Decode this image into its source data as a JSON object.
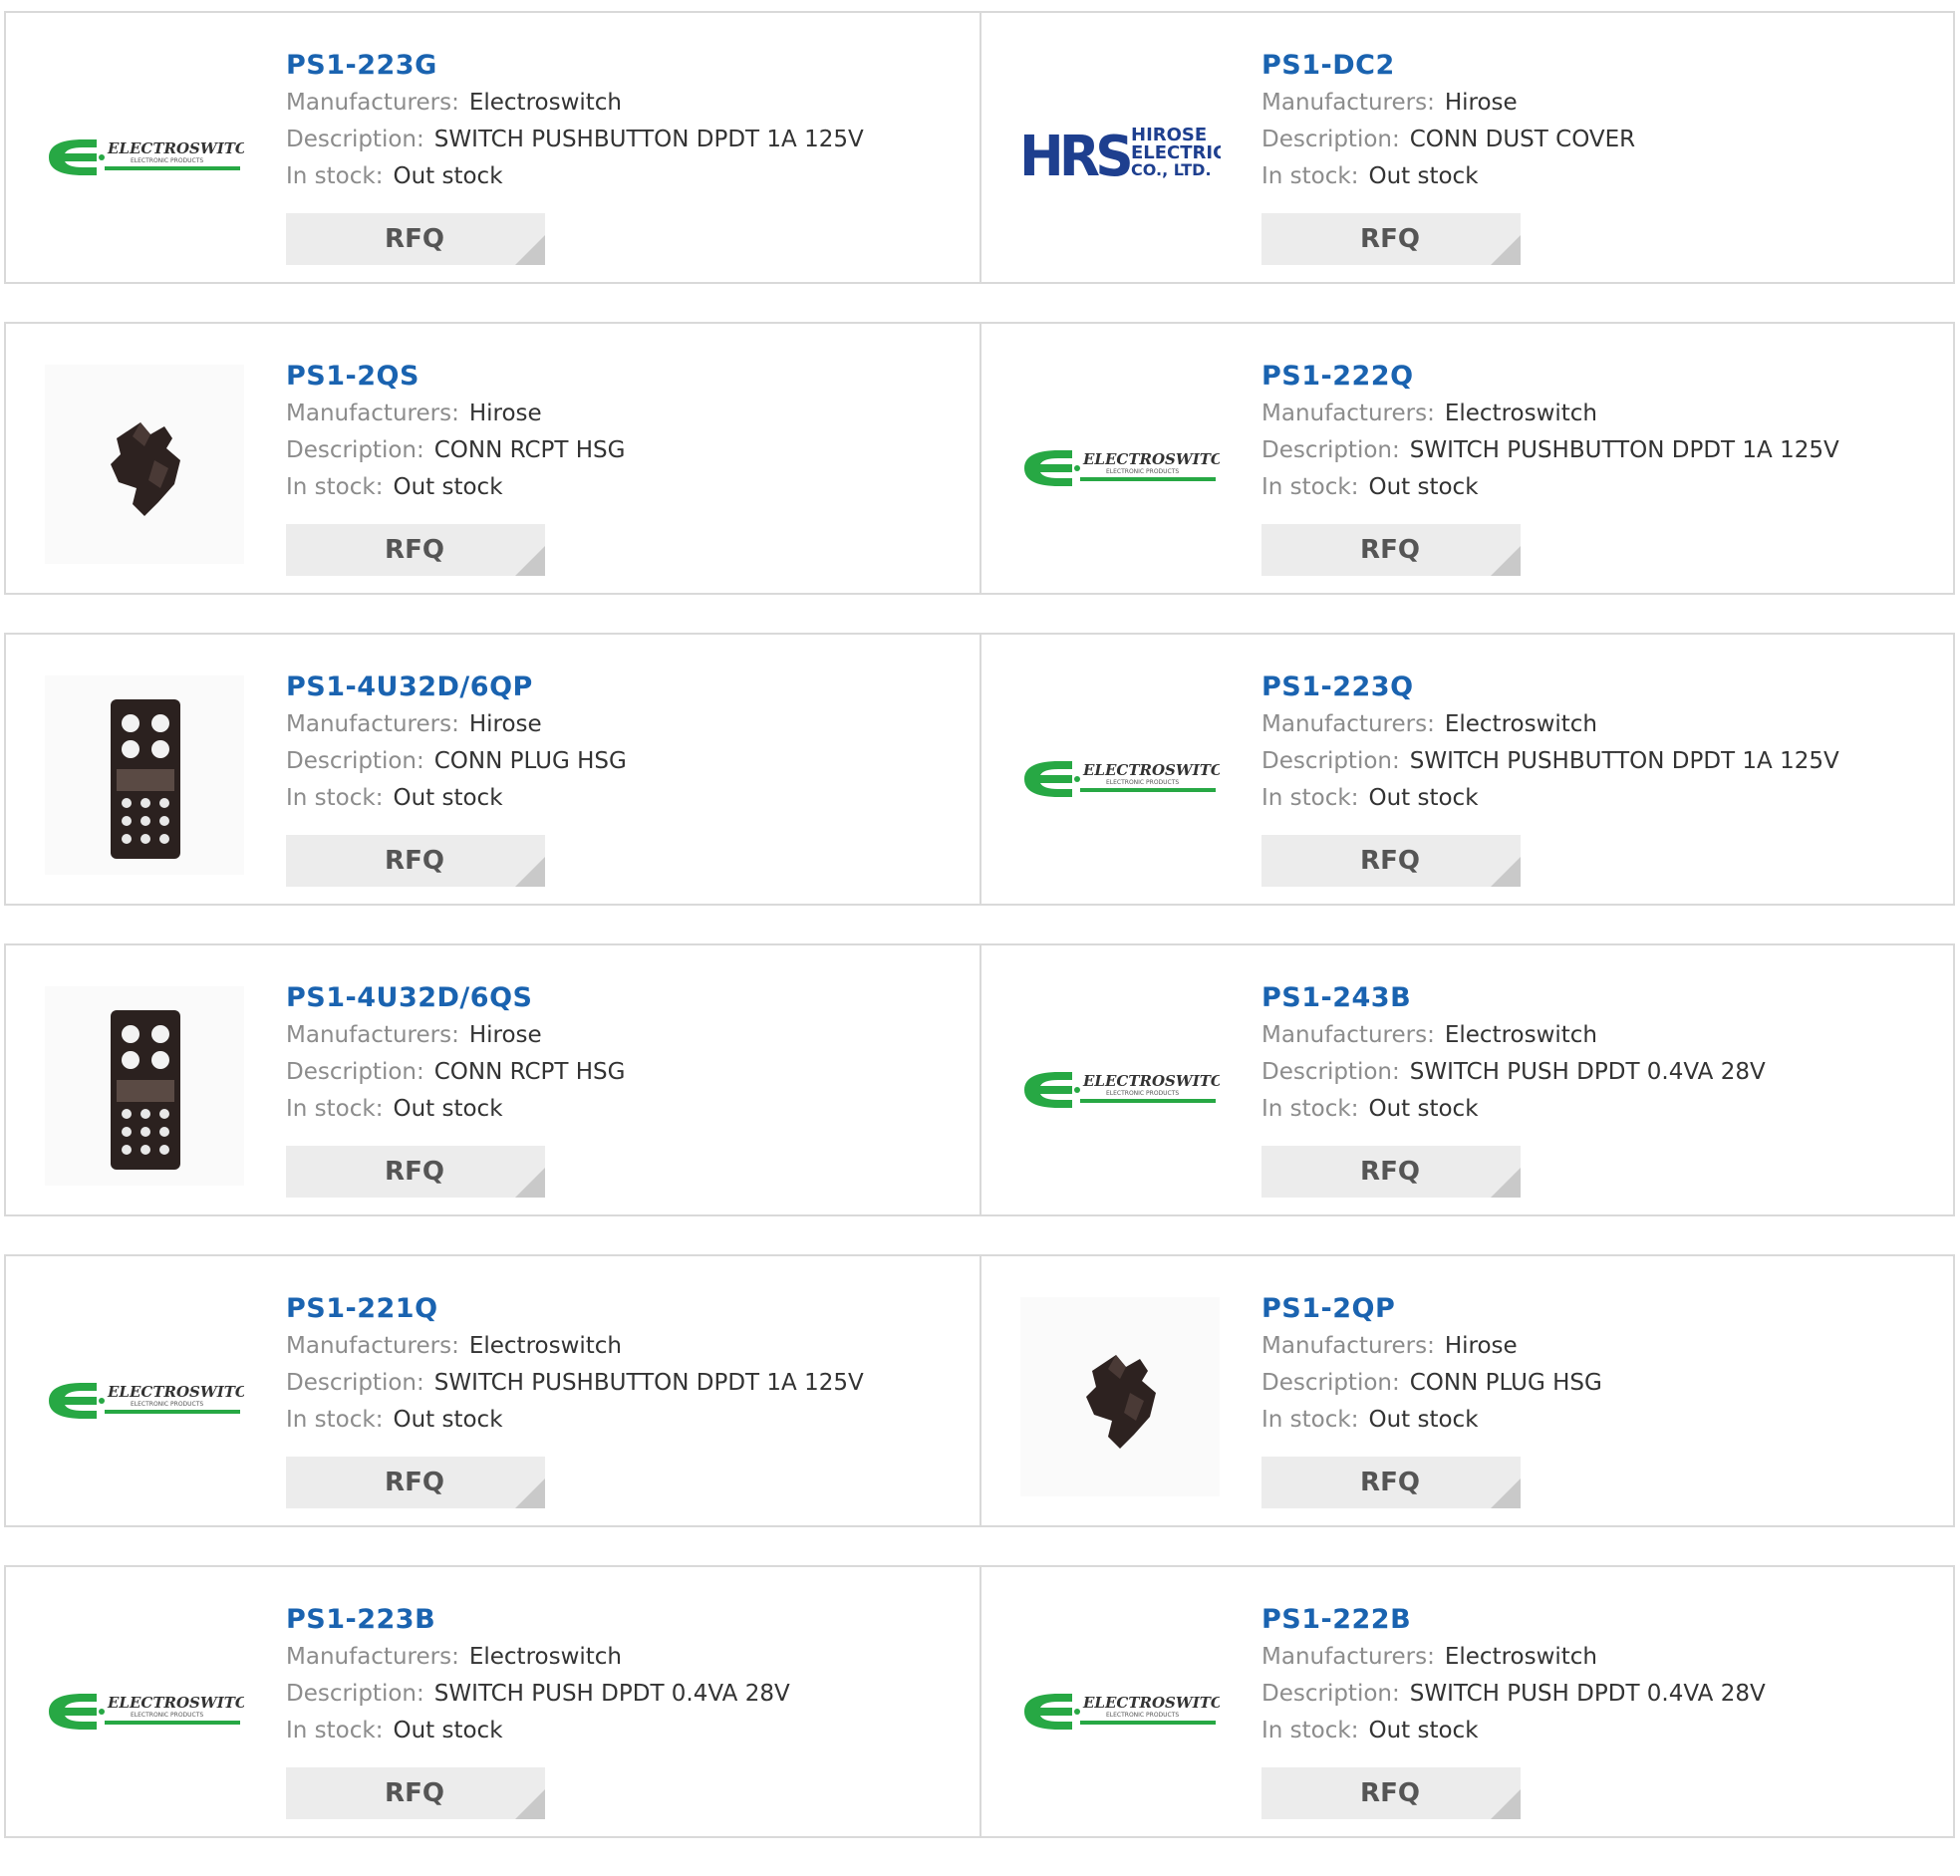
{
  "labels": {
    "manufacturers": "Manufacturers:",
    "description": "Description:",
    "in_stock": "In stock:",
    "rfq": "RFQ"
  },
  "colors": {
    "title_blue": "#1a63b0",
    "label_gray": "#8c8c8c",
    "value_dark": "#333333",
    "electroswitch_green": "#27a844",
    "hirose_blue": "#1e3f8f"
  },
  "logos": {
    "electroswitch": {
      "name": "ELECTROSWITCH",
      "tagline": "ELECTRONIC PRODUCTS"
    },
    "hirose": {
      "mark": "HRS",
      "line1": "HIROSE",
      "line2": "ELECTRIC",
      "line3": "CO., LTD."
    }
  },
  "products": [
    {
      "part": "PS1-223G",
      "manufacturer": "Electroswitch",
      "description": "SWITCH PUSHBUTTON DPDT 1A 125V",
      "stock": "Out stock",
      "image": "electroswitch-logo"
    },
    {
      "part": "PS1-DC2",
      "manufacturer": "Hirose",
      "description": "CONN DUST COVER",
      "stock": "Out stock",
      "image": "hirose-logo"
    },
    {
      "part": "PS1-2QS",
      "manufacturer": "Hirose",
      "description": "CONN RCPT HSG",
      "stock": "Out stock",
      "image": "connector-photo"
    },
    {
      "part": "PS1-222Q",
      "manufacturer": "Electroswitch",
      "description": "SWITCH PUSHBUTTON DPDT 1A 125V",
      "stock": "Out stock",
      "image": "electroswitch-logo"
    },
    {
      "part": "PS1-4U32D/6QP",
      "manufacturer": "Hirose",
      "description": "CONN PLUG HSG",
      "stock": "Out stock",
      "image": "connector-block-photo"
    },
    {
      "part": "PS1-223Q",
      "manufacturer": "Electroswitch",
      "description": "SWITCH PUSHBUTTON DPDT 1A 125V",
      "stock": "Out stock",
      "image": "electroswitch-logo"
    },
    {
      "part": "PS1-4U32D/6QS",
      "manufacturer": "Hirose",
      "description": "CONN RCPT HSG",
      "stock": "Out stock",
      "image": "connector-block-photo"
    },
    {
      "part": "PS1-243B",
      "manufacturer": "Electroswitch",
      "description": "SWITCH PUSH DPDT 0.4VA 28V",
      "stock": "Out stock",
      "image": "electroswitch-logo"
    },
    {
      "part": "PS1-221Q",
      "manufacturer": "Electroswitch",
      "description": "SWITCH PUSHBUTTON DPDT 1A 125V",
      "stock": "Out stock",
      "image": "electroswitch-logo"
    },
    {
      "part": "PS1-2QP",
      "manufacturer": "Hirose",
      "description": "CONN PLUG HSG",
      "stock": "Out stock",
      "image": "connector-photo"
    },
    {
      "part": "PS1-223B",
      "manufacturer": "Electroswitch",
      "description": "SWITCH PUSH DPDT 0.4VA 28V",
      "stock": "Out stock",
      "image": "electroswitch-logo"
    },
    {
      "part": "PS1-222B",
      "manufacturer": "Electroswitch",
      "description": "SWITCH PUSH DPDT 0.4VA 28V",
      "stock": "Out stock",
      "image": "electroswitch-logo"
    }
  ]
}
